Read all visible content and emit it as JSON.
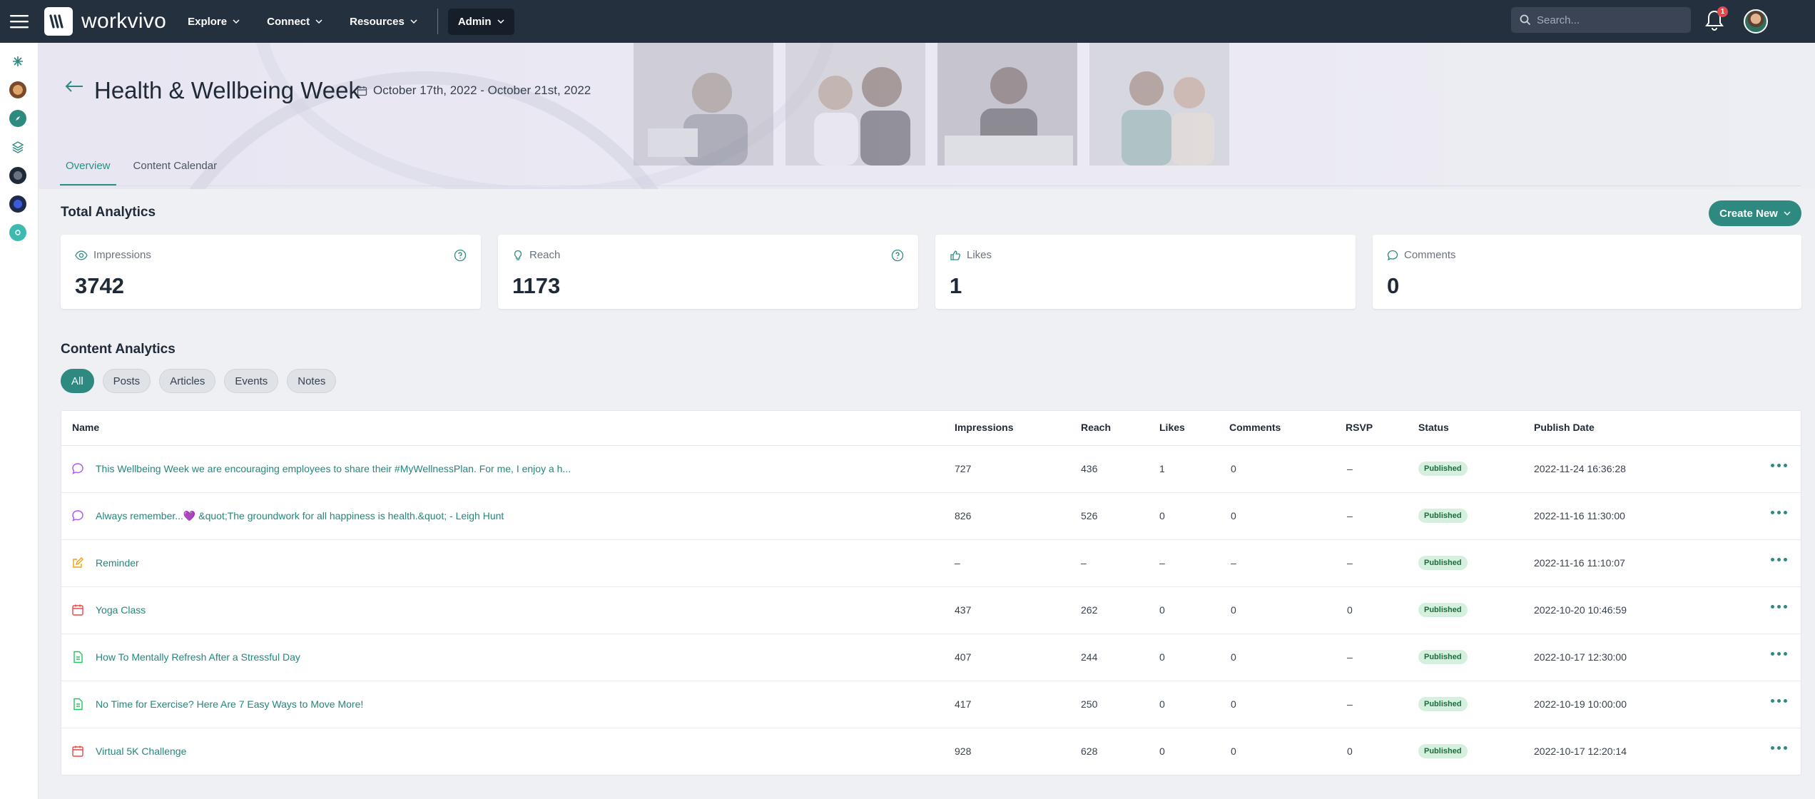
{
  "app": {
    "name": "workvivo",
    "nav": [
      {
        "label": "Explore"
      },
      {
        "label": "Connect"
      },
      {
        "label": "Resources"
      }
    ],
    "admin_label": "Admin",
    "search_placeholder": "Search...",
    "notification_count": "1"
  },
  "page": {
    "title": "Health & Wellbeing Week",
    "date_range": "October 17th, 2022 - October 21st, 2022",
    "tabs": [
      {
        "label": "Overview",
        "active": true
      },
      {
        "label": "Content Calendar",
        "active": false
      }
    ]
  },
  "total_analytics": {
    "title": "Total Analytics",
    "create_label": "Create New",
    "cards": [
      {
        "label": "Impressions",
        "value": "3742",
        "icon": "eye-icon"
      },
      {
        "label": "Reach",
        "value": "1173",
        "icon": "lightbulb-icon"
      },
      {
        "label": "Likes",
        "value": "1",
        "icon": "thumbs-up-icon"
      },
      {
        "label": "Comments",
        "value": "0",
        "icon": "comment-icon"
      }
    ]
  },
  "content_analytics": {
    "title": "Content Analytics",
    "filters": [
      {
        "label": "All",
        "active": true
      },
      {
        "label": "Posts"
      },
      {
        "label": "Articles"
      },
      {
        "label": "Events"
      },
      {
        "label": "Notes"
      }
    ],
    "columns": [
      "Name",
      "Impressions",
      "Reach",
      "Likes",
      "Comments",
      "RSVP",
      "Status",
      "Publish Date"
    ],
    "rows": [
      {
        "type": "post",
        "name": "This Wellbeing Week we are encouraging employees to share their #MyWellnessPlan. For me, I enjoy a h...",
        "impressions": "727",
        "reach": "436",
        "likes": "1",
        "comments": "0",
        "rsvp": "–",
        "status": "Published",
        "date": "2022-11-24 16:36:28"
      },
      {
        "type": "post",
        "name": "Always remember...💜 &quot;The groundwork for all happiness is health.&quot; - Leigh Hunt",
        "impressions": "826",
        "reach": "526",
        "likes": "0",
        "comments": "0",
        "rsvp": "–",
        "status": "Published",
        "date": "2022-11-16 11:30:00"
      },
      {
        "type": "note",
        "name": "Reminder",
        "impressions": "–",
        "reach": "–",
        "likes": "–",
        "comments": "–",
        "rsvp": "–",
        "status": "Published",
        "date": "2022-11-16 11:10:07"
      },
      {
        "type": "event",
        "name": "Yoga Class",
        "impressions": "437",
        "reach": "262",
        "likes": "0",
        "comments": "0",
        "rsvp": "0",
        "status": "Published",
        "date": "2022-10-20 10:46:59"
      },
      {
        "type": "article",
        "name": "How To Mentally Refresh After a Stressful Day",
        "impressions": "407",
        "reach": "244",
        "likes": "0",
        "comments": "0",
        "rsvp": "–",
        "status": "Published",
        "date": "2022-10-17 12:30:00"
      },
      {
        "type": "article",
        "name": "No Time for Exercise? Here Are 7 Easy Ways to Move More!",
        "impressions": "417",
        "reach": "250",
        "likes": "0",
        "comments": "0",
        "rsvp": "–",
        "status": "Published",
        "date": "2022-10-19 10:00:00"
      },
      {
        "type": "event",
        "name": "Virtual 5K Challenge",
        "impressions": "928",
        "reach": "628",
        "likes": "0",
        "comments": "0",
        "rsvp": "0",
        "status": "Published",
        "date": "2022-10-17 12:20:14"
      }
    ]
  },
  "colors": {
    "topbar": "#25303f",
    "accent": "#2e8a80",
    "link": "#22877d",
    "badge_bg": "#d6f0df",
    "post_icon": "#a855f7",
    "note_icon": "#f59e0b",
    "event_icon": "#ef4444",
    "article_icon": "#22c55e"
  }
}
